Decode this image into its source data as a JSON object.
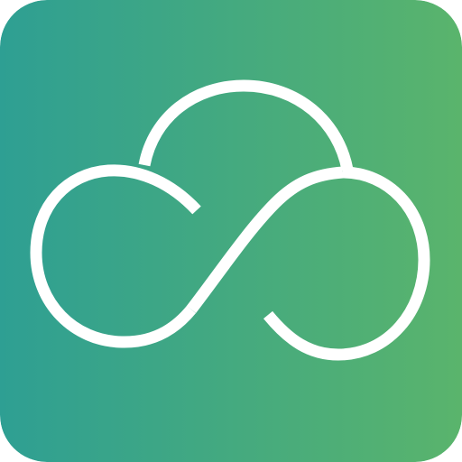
{
  "app_icon": {
    "icon": "cloud-infinity-icon",
    "colors": {
      "gradient_start": "#2e9f93",
      "gradient_end": "#5ab46c",
      "stroke": "#ffffff"
    }
  }
}
